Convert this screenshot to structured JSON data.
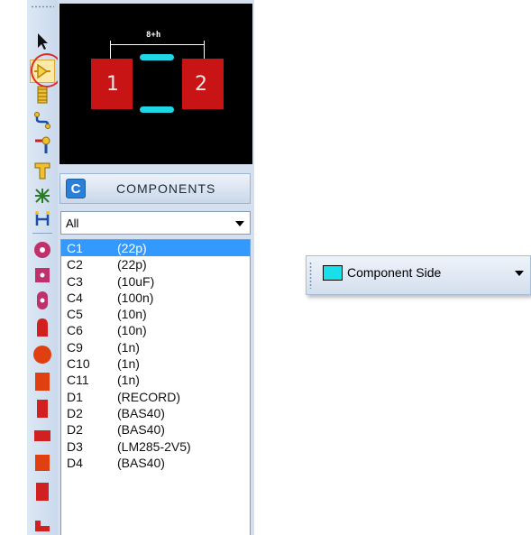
{
  "preview": {
    "pad1_label": "1",
    "pad2_label": "2",
    "dimension_label": "8+h",
    "pad_color": "#c81414",
    "silk_color": "#1fd6e6"
  },
  "components": {
    "title": "COMPONENTS",
    "button_letter": "C",
    "filter_value": "All",
    "items": [
      {
        "ref": "C1",
        "value": "(22p)",
        "selected": true
      },
      {
        "ref": "C2",
        "value": "(22p)"
      },
      {
        "ref": "C3",
        "value": "(10uF)"
      },
      {
        "ref": "C4",
        "value": "(100n)"
      },
      {
        "ref": "C5",
        "value": "(10n)"
      },
      {
        "ref": "C6",
        "value": "(10n)"
      },
      {
        "ref": "C9",
        "value": "(1n)"
      },
      {
        "ref": "C10",
        "value": "(1n)"
      },
      {
        "ref": "C11",
        "value": "(1n)"
      },
      {
        "ref": "D1",
        "value": "(RECORD)"
      },
      {
        "ref": "D2",
        "value": "(BAS40)"
      },
      {
        "ref": "D2",
        "value": "(BAS40)"
      },
      {
        "ref": "D3",
        "value": "(LM285-2V5)"
      },
      {
        "ref": "D4",
        "value": "(BAS40)"
      }
    ]
  },
  "layer_selector": {
    "label": "Component Side",
    "color": "#18e0ea"
  },
  "toolbar": {
    "tools": [
      "select-pointer-icon",
      "component-mode-icon",
      "package-icon",
      "track-icon",
      "via-icon",
      "zone-icon",
      "ratsnest-icon",
      "connectivity-icon",
      "round-pad-icon",
      "square-pad-icon",
      "oval-pad-icon",
      "dil-pad-icon",
      "large-round-pad-icon",
      "large-square-pad-icon",
      "edge-pad-icon"
    ],
    "active_tool": "component-mode-icon",
    "highlight_color": "#e02a2a"
  }
}
